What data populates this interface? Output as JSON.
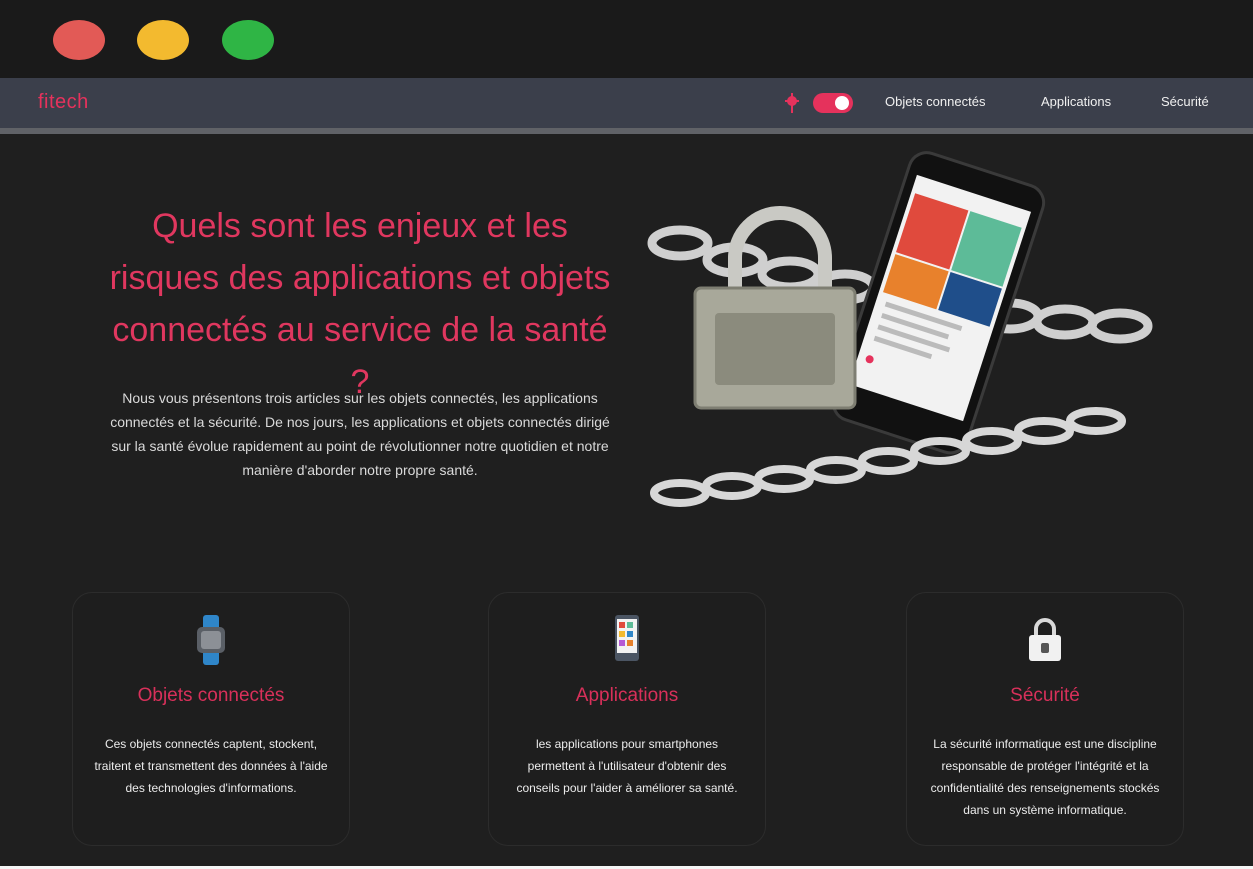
{
  "window": {
    "controls": [
      "close",
      "minimize",
      "maximize"
    ]
  },
  "navbar": {
    "brand": "fitech",
    "icons": [
      "pin-icon",
      "theme-toggle"
    ],
    "links": [
      "Objets connectés",
      "Applications",
      "Sécurité"
    ]
  },
  "hero": {
    "title": "Quels sont les enjeux et les risques des applications et objets connectés au service de la santé ?",
    "text": "Nous vous présentons trois articles sur les objets connectés, les applications connectés et la sécurité. De nos jours, les applications et objets connectés dirigé sur la santé évolue rapidement au point de révolutionner notre quotidien et notre manière d'aborder notre propre santé."
  },
  "cards": [
    {
      "icon": "smartwatch-icon",
      "title": "Objets connectés",
      "text": "Ces objets connectés captent, stockent, traitent et transmettent des données à l'aide des technologies d'informations."
    },
    {
      "icon": "smartphone-icon",
      "title": "Applications",
      "text": "les applications pour smartphones permettent à l'utilisateur d'obtenir des conseils pour l'aider à améliorer sa santé."
    },
    {
      "icon": "padlock-icon",
      "title": "Sécurité",
      "text": "La sécurité informatique est une discipline responsable de protéger l'intégrité et la confidentialité des renseignements stockés dans un système informatique."
    }
  ],
  "colors": {
    "accent": "#e5325c",
    "background": "#1f1f1f",
    "navbar": "#3b3f4b"
  }
}
